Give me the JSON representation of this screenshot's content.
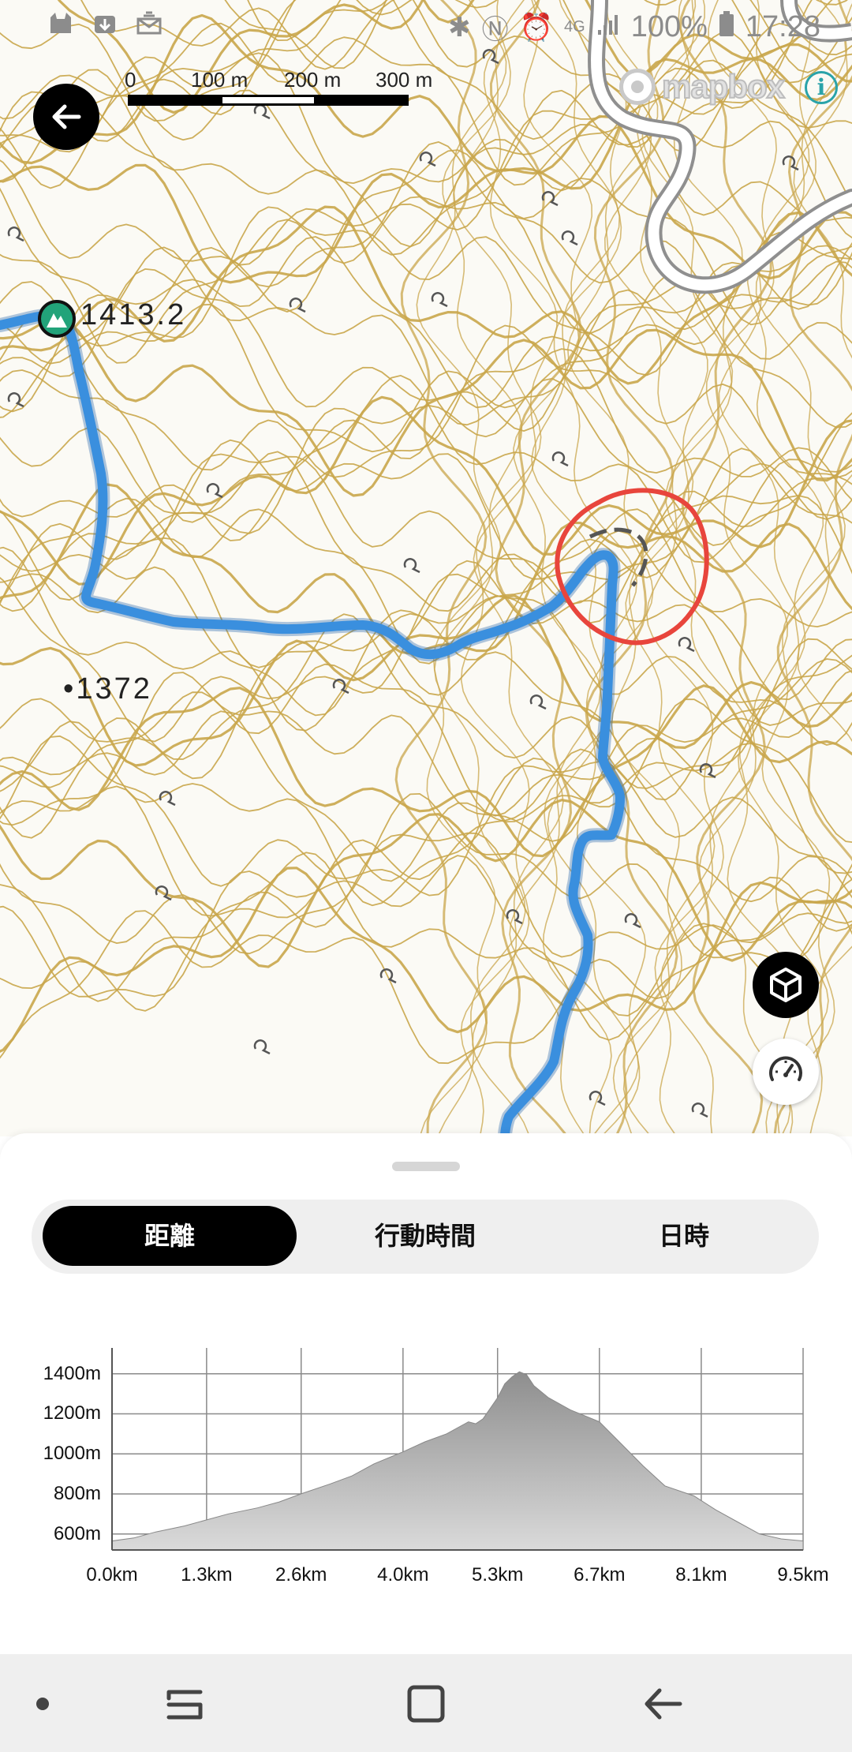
{
  "status_bar": {
    "battery": "100%",
    "time": "17:28",
    "network": "4G",
    "left_icons": [
      "cat-icon",
      "download-icon",
      "message-icon"
    ],
    "right_icons": [
      "bluetooth-icon",
      "nfc-icon",
      "alarm-icon",
      "signal-icon",
      "battery-icon"
    ]
  },
  "map": {
    "scale": {
      "labels": [
        "0",
        "100 m",
        "200 m",
        "300 m"
      ]
    },
    "attribution": "mapbox",
    "info_label": "i",
    "summit_elevation": "1413.2",
    "point_elevation": "1372",
    "colors": {
      "contour": "#c9a64b",
      "route": "#3a8fde",
      "highlight_circle": "#e8453c"
    }
  },
  "buttons": {
    "back_icon": "arrow-left-icon",
    "view_3d_icon": "cube-icon",
    "speed_icon": "speedometer-icon"
  },
  "tabs": {
    "items": [
      {
        "label": "距離",
        "active": true
      },
      {
        "label": "行動時間",
        "active": false
      },
      {
        "label": "日時",
        "active": false
      }
    ]
  },
  "chart_data": {
    "type": "area",
    "title": "",
    "xlabel": "",
    "ylabel": "",
    "x_ticks": [
      "0.0km",
      "1.3km",
      "2.6km",
      "4.0km",
      "5.3km",
      "6.7km",
      "8.1km",
      "9.5km"
    ],
    "y_ticks": [
      "600m",
      "800m",
      "1000m",
      "1200m",
      "1400m"
    ],
    "xlim": [
      0,
      9.5
    ],
    "ylim": [
      500,
      1500
    ],
    "grid": true,
    "series": [
      {
        "x": [
          0.0,
          0.3,
          0.6,
          1.0,
          1.3,
          1.6,
          2.0,
          2.3,
          2.6,
          3.0,
          3.3,
          3.6,
          4.0,
          4.3,
          4.6,
          4.9,
          5.0,
          5.1,
          5.3,
          5.4,
          5.5,
          5.6,
          5.7,
          5.8,
          6.0,
          6.3,
          6.7,
          7.0,
          7.3,
          7.6,
          8.0,
          8.3,
          8.6,
          8.9,
          9.2,
          9.5
        ],
        "y": [
          565,
          580,
          610,
          640,
          670,
          700,
          730,
          760,
          800,
          850,
          890,
          950,
          1010,
          1060,
          1100,
          1160,
          1150,
          1175,
          1280,
          1350,
          1385,
          1410,
          1395,
          1340,
          1280,
          1220,
          1160,
          1050,
          940,
          840,
          790,
          720,
          660,
          600,
          575,
          565
        ]
      }
    ]
  },
  "nav_bar": {
    "icons": [
      "dot-icon",
      "recents-icon",
      "home-icon",
      "back-icon"
    ]
  }
}
